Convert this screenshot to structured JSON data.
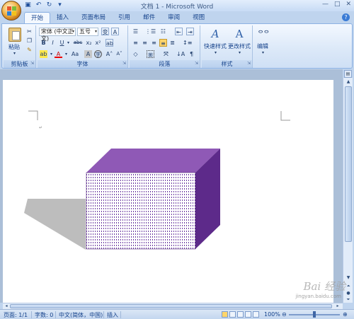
{
  "window": {
    "title": "文档 1 - Microsoft Word",
    "controls": [
      "—",
      "□",
      "✕"
    ]
  },
  "tabs": [
    {
      "label": "开始",
      "active": true
    },
    {
      "label": "插入",
      "active": false
    },
    {
      "label": "页面布局",
      "active": false
    },
    {
      "label": "引用",
      "active": false
    },
    {
      "label": "邮件",
      "active": false
    },
    {
      "label": "审阅",
      "active": false
    },
    {
      "label": "视图",
      "active": false
    }
  ],
  "ribbon": {
    "clipboard": {
      "paste_label": "粘贴",
      "group_label": "剪贴板"
    },
    "font": {
      "font_name": "宋体 (中文正文)",
      "font_size": "五号",
      "group_label": "字体"
    },
    "paragraph": {
      "group_label": "段落"
    },
    "styles": {
      "quick_styles_label": "快速样式",
      "change_styles_label": "更改样式",
      "group_label": "样式"
    },
    "editing": {
      "label": "编辑"
    }
  },
  "status_bar": {
    "page": "页面: 1/1",
    "words": "字数: 0",
    "language": "中文(简体，中国)",
    "mode": "插入",
    "zoom": "100%"
  },
  "watermark": {
    "text": "Bai 经验",
    "sub": "jingyan.baidu.com"
  },
  "colors": {
    "box_top": "#8f59b6",
    "box_side": "#5d2a8a",
    "box_front_dots": "#6a3aa0",
    "shadow": "#bdbdbd",
    "ribbon_border": "#8db2e3"
  }
}
